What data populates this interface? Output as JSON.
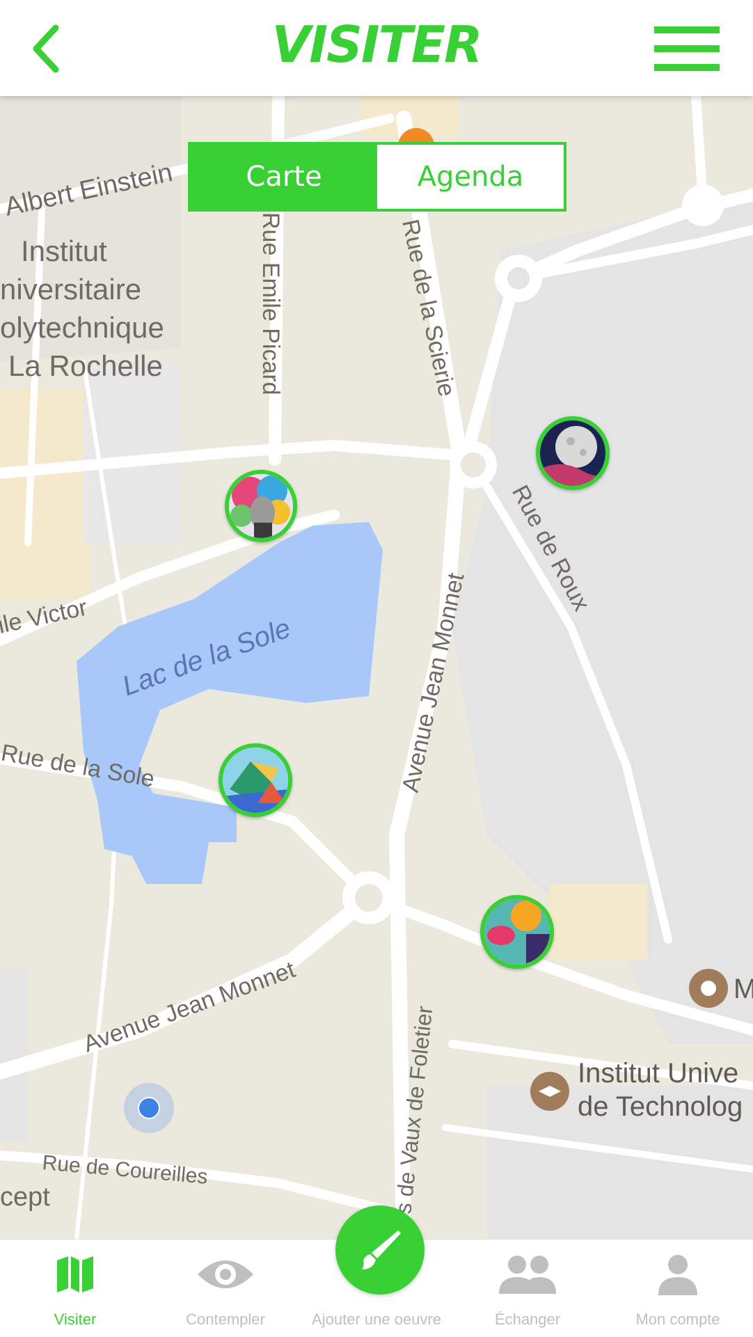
{
  "header": {
    "title": "VISITER",
    "back_icon": "chevron-left-icon",
    "menu_icon": "hamburger-menu-icon"
  },
  "colors": {
    "accent": "#39d035",
    "inactive": "#bfbfbf",
    "water": "#a8c8f9",
    "map_bg": "#ebe8de"
  },
  "view_toggle": {
    "options": [
      "Carte",
      "Agenda"
    ],
    "selected": "Carte"
  },
  "map": {
    "labels": {
      "albert_einstein": "Albert Einstein",
      "iup_line1": "Institut",
      "iup_line2": "niversitaire",
      "iup_line3": "olytechnique",
      "iup_line4": "La Rochelle",
      "rue_emile_picard": "Rue Emile Picard",
      "rue_de_la_scierie": "Rue de la Scierie",
      "rue_de_roux": "Rue de Roux",
      "ile_victor": "ile Victor",
      "lac_de_la_sole": "Lac de la Sole",
      "rue_de_la_sole": "Rue de la Sole",
      "avenue_jean_monnet_1": "Avenue Jean Monnet",
      "avenue_jean_monnet_2": "Avenue Jean Monnet",
      "vaux_de_foletier": "s de Vaux de Foletier",
      "rue_de_coureilles": "Rue de Coureilles",
      "cept": "cept",
      "iut_line1": "Institut Unive",
      "iut_line2": "de Technolog",
      "m_label": "M"
    },
    "markers": [
      "artwork-marker-portrait",
      "artwork-marker-moon",
      "artwork-marker-geometric",
      "artwork-marker-graffiti"
    ],
    "current_location_icon": "current-location-dot"
  },
  "fab": {
    "icon": "paintbrush-icon"
  },
  "bottom_nav": {
    "items": [
      {
        "label": "Visiter",
        "icon": "map-icon",
        "active": true
      },
      {
        "label": "Contempler",
        "icon": "eye-icon",
        "active": false
      },
      {
        "label": "Ajouter une oeuvre",
        "icon": "paintbrush-icon",
        "active": false
      },
      {
        "label": "Échanger",
        "icon": "people-icon",
        "active": false
      },
      {
        "label": "Mon compte",
        "icon": "person-icon",
        "active": false
      }
    ]
  }
}
